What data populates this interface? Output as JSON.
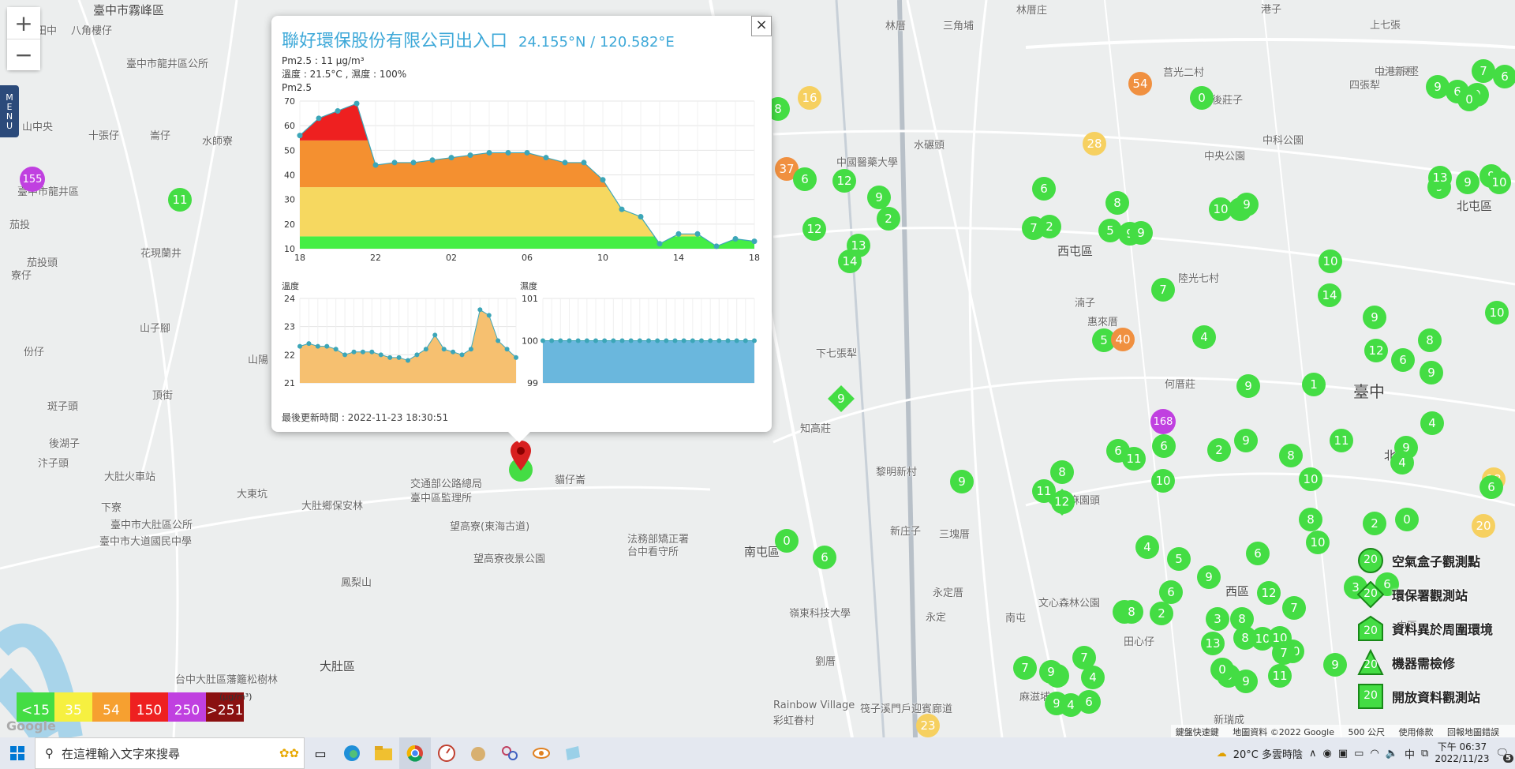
{
  "map": {
    "zoom_in": "+",
    "zoom_out": "−",
    "menu_label": "MENU",
    "places": [
      {
        "text": "臺中市霧峰區",
        "k": "district"
      },
      {
        "text": "八角樓仔"
      },
      {
        "text": "臺中市龍井區公所"
      },
      {
        "text": "田中"
      },
      {
        "text": "十張仔"
      },
      {
        "text": "崙仔"
      },
      {
        "text": "水師寮"
      },
      {
        "text": "山中央"
      },
      {
        "text": "臺中市龍井區"
      },
      {
        "text": "茄投"
      },
      {
        "text": "茄投頭"
      },
      {
        "text": "花現蘭井"
      },
      {
        "text": "寮仔"
      },
      {
        "text": "份仔"
      },
      {
        "text": "山子腳"
      },
      {
        "text": "山陽"
      },
      {
        "text": "頂街"
      },
      {
        "text": "斑子頭"
      },
      {
        "text": "後湖子"
      },
      {
        "text": "汴子頭"
      },
      {
        "text": "下寮"
      },
      {
        "text": "大肚火車站"
      },
      {
        "text": "臺中市大肚區公所"
      },
      {
        "text": "大東坑"
      },
      {
        "text": "大肚鄉保安林"
      },
      {
        "text": "交通部公路總局"
      },
      {
        "text": "臺中區監理所"
      },
      {
        "text": "望高寮(東海古道)"
      },
      {
        "text": "望高寮夜景公園"
      },
      {
        "text": "鳳梨山"
      },
      {
        "text": "臺中市大道國民中學"
      },
      {
        "text": "大肚區",
        "k": "district"
      },
      {
        "text": "台中大肚區藩籬松樹林"
      },
      {
        "text": "貓仔崙"
      },
      {
        "text": "法務部矯正署"
      },
      {
        "text": "台中看守所"
      },
      {
        "text": "林厝"
      },
      {
        "text": "三角埔"
      },
      {
        "text": "林厝庄"
      },
      {
        "text": "港子"
      },
      {
        "text": "上七張"
      },
      {
        "text": "上七張堅"
      },
      {
        "text": "中港新村"
      },
      {
        "text": "四張犁"
      },
      {
        "text": "後莊子"
      },
      {
        "text": "莒光二村"
      },
      {
        "text": "中科公園"
      },
      {
        "text": "中國醫藥大學"
      },
      {
        "text": "水碾頭"
      },
      {
        "text": "中央公園"
      },
      {
        "text": "西屯區",
        "k": "district"
      },
      {
        "text": "北屯區",
        "k": "district"
      },
      {
        "text": "陸光七村"
      },
      {
        "text": "湳子"
      },
      {
        "text": "惠來厝"
      },
      {
        "text": "下七張犁"
      },
      {
        "text": "何厝莊"
      },
      {
        "text": "臺中",
        "k": "city"
      },
      {
        "text": "北區",
        "k": "district"
      },
      {
        "text": "知高莊"
      },
      {
        "text": "黎明新村"
      },
      {
        "text": "新庄子"
      },
      {
        "text": "三塊厝"
      },
      {
        "text": "麻園頭"
      },
      {
        "text": "南屯區",
        "k": "district"
      },
      {
        "text": "永定厝"
      },
      {
        "text": "永定"
      },
      {
        "text": "南屯"
      },
      {
        "text": "文心森林公園"
      },
      {
        "text": "田心仔"
      },
      {
        "text": "西區",
        "k": "district"
      },
      {
        "text": "嶺東科技大學"
      },
      {
        "text": "劉厝"
      },
      {
        "text": "筏子溪門戶迎賓廊道"
      },
      {
        "text": "Rainbow Village"
      },
      {
        "text": "彩虹眷村"
      },
      {
        "text": "麻滋埔"
      },
      {
        "text": "新瑞成"
      },
      {
        "text": "中區"
      }
    ],
    "markers": [
      {
        "v": "155",
        "c": "#c040e0"
      },
      {
        "v": "11",
        "c": "#44dd44"
      },
      {
        "v": "8",
        "c": "#44dd44"
      },
      {
        "v": "16",
        "c": "#f6d060"
      },
      {
        "v": "37",
        "c": "#f09040"
      },
      {
        "v": "6",
        "c": "#44dd44"
      },
      {
        "v": "12",
        "c": "#44dd44"
      },
      {
        "v": "9",
        "c": "#44dd44"
      },
      {
        "v": "2",
        "c": "#44dd44"
      },
      {
        "v": "12",
        "c": "#44dd44"
      },
      {
        "v": "13",
        "c": "#44dd44"
      },
      {
        "v": "14",
        "c": "#44dd44"
      },
      {
        "v": "54",
        "c": "#f09040"
      },
      {
        "v": "0",
        "c": "#44dd44"
      },
      {
        "v": "28",
        "c": "#f6d060"
      },
      {
        "v": "6",
        "c": "#44dd44"
      },
      {
        "v": "7",
        "c": "#44dd44"
      },
      {
        "v": "2",
        "c": "#44dd44"
      },
      {
        "v": "8",
        "c": "#44dd44"
      },
      {
        "v": "5",
        "c": "#44dd44"
      },
      {
        "v": "9",
        "c": "#44dd44"
      },
      {
        "v": "9",
        "c": "#44dd44"
      },
      {
        "v": "7",
        "c": "#44dd44"
      },
      {
        "v": "5",
        "c": "#44dd44"
      },
      {
        "v": "40",
        "c": "#f09040"
      },
      {
        "v": "4",
        "c": "#44dd44"
      },
      {
        "v": "9",
        "c": "#44dd44"
      },
      {
        "v": "168",
        "c": "#c040e0"
      },
      {
        "v": "6",
        "c": "#44dd44"
      },
      {
        "v": "6",
        "c": "#44dd44"
      },
      {
        "v": "2",
        "c": "#44dd44"
      },
      {
        "v": "9",
        "c": "#44dd44"
      },
      {
        "v": "8",
        "c": "#44dd44"
      },
      {
        "v": "11",
        "c": "#44dd44"
      },
      {
        "v": "12",
        "c": "#44dd44"
      },
      {
        "v": "11",
        "c": "#44dd44"
      },
      {
        "v": "10",
        "c": "#44dd44"
      },
      {
        "v": "9",
        "c": "#44dd44"
      },
      {
        "v": "0",
        "c": "#44dd44"
      },
      {
        "v": "6",
        "c": "#44dd44"
      },
      {
        "v": "7",
        "c": "#44dd44"
      },
      {
        "v": "9",
        "c": "#44dd44"
      },
      {
        "v": "9",
        "c": "#44dd44"
      },
      {
        "v": "2",
        "c": "#44dd44"
      },
      {
        "v": "13",
        "c": "#44dd44"
      },
      {
        "v": "8",
        "c": "#44dd44"
      },
      {
        "v": "10",
        "c": "#44dd44"
      },
      {
        "v": "10",
        "c": "#44dd44"
      },
      {
        "v": "11",
        "c": "#44dd44"
      },
      {
        "v": "7",
        "c": "#44dd44"
      },
      {
        "v": "10",
        "c": "#44dd44"
      },
      {
        "v": "9",
        "c": "#44dd44"
      },
      {
        "v": "14",
        "c": "#44dd44"
      },
      {
        "v": "10",
        "c": "#44dd44"
      },
      {
        "v": "12",
        "c": "#44dd44"
      },
      {
        "v": "9",
        "c": "#44dd44"
      },
      {
        "v": "8",
        "c": "#44dd44"
      },
      {
        "v": "9",
        "c": "#44dd44"
      },
      {
        "v": "6",
        "c": "#44dd44"
      },
      {
        "v": "1",
        "c": "#44dd44"
      },
      {
        "v": "11",
        "c": "#44dd44"
      },
      {
        "v": "8",
        "c": "#44dd44"
      },
      {
        "v": "9",
        "c": "#44dd44"
      },
      {
        "v": "4",
        "c": "#44dd44"
      },
      {
        "v": "10",
        "c": "#44dd44"
      },
      {
        "v": "18",
        "c": "#f6d060"
      },
      {
        "v": "20",
        "c": "#f6d060"
      },
      {
        "v": "0",
        "c": "#44dd44"
      },
      {
        "v": "8",
        "c": "#44dd44"
      },
      {
        "v": "10",
        "c": "#44dd44"
      },
      {
        "v": "6",
        "c": "#44dd44"
      },
      {
        "v": "12",
        "c": "#44dd44"
      },
      {
        "v": "3",
        "c": "#44dd44"
      },
      {
        "v": "6",
        "c": "#44dd44"
      },
      {
        "v": "5",
        "c": "#44dd44"
      },
      {
        "v": "8",
        "c": "#44dd44"
      },
      {
        "v": "4",
        "c": "#44dd44"
      },
      {
        "v": "5",
        "c": "#44dd44"
      },
      {
        "v": "9",
        "c": "#44dd44"
      },
      {
        "v": "8",
        "c": "#44dd44"
      },
      {
        "v": "9",
        "c": "#44dd44"
      },
      {
        "v": "7",
        "c": "#44dd44"
      },
      {
        "v": "3",
        "c": "#44dd44"
      },
      {
        "v": "0",
        "c": "#44dd44"
      },
      {
        "v": "9",
        "c": "#44dd44"
      },
      {
        "v": "7",
        "c": "#44dd44"
      },
      {
        "v": "4",
        "c": "#44dd44"
      },
      {
        "v": "6",
        "c": "#44dd44"
      },
      {
        "v": "4",
        "c": "#44dd44"
      },
      {
        "v": "23",
        "c": "#f6d060"
      },
      {
        "v": "7",
        "c": "#44dd44"
      },
      {
        "v": "6",
        "c": "#44dd44"
      },
      {
        "v": "9",
        "c": "#44dd44"
      },
      {
        "v": "0",
        "c": "#44dd44"
      },
      {
        "v": "6",
        "c": "#44dd44"
      },
      {
        "v": "9",
        "c": "#44dd44"
      },
      {
        "v": "9",
        "c": "#44dd44"
      },
      {
        "v": "9",
        "c": "#44dd44"
      },
      {
        "v": "9",
        "c": "#44dd44"
      },
      {
        "v": "6",
        "c": "#44dd44"
      },
      {
        "v": "4",
        "c": "#44dd44"
      },
      {
        "v": "2",
        "c": "#44dd44"
      },
      {
        "v": "3",
        "c": "#44dd44"
      },
      {
        "v": "6",
        "c": "#44dd44"
      },
      {
        "v": "13",
        "c": "#44dd44"
      },
      {
        "v": "10",
        "c": "#44dd44"
      },
      {
        "v": "10",
        "c": "#44dd44"
      },
      {
        "v": "7",
        "c": "#44dd44"
      },
      {
        "v": "9",
        "c": "#44dd44"
      },
      {
        "v": "10",
        "c": "#44dd44"
      }
    ],
    "diamonds": [
      {
        "v": "9",
        "c": "#44dd44"
      },
      {
        "v": "12",
        "c": "#44dd44"
      }
    ]
  },
  "popup": {
    "close_label": "×",
    "station_name": "聯好環保股份有限公司出入口",
    "coordinates": "24.155°N / 120.582°E",
    "pm25_line": "Pm2.5 : 11 μg/m³",
    "weather_line": "溫度 : 21.5°C , 濕度 : 100%",
    "chart_heading": "Pm2.5",
    "updated": "最後更新時間 : 2022-11-23 18:30:51"
  },
  "chart_data": [
    {
      "type": "area",
      "title": "Pm2.5",
      "x": [
        "18",
        "19",
        "20",
        "21",
        "22",
        "23",
        "00",
        "01",
        "02",
        "03",
        "04",
        "05",
        "06",
        "07",
        "08",
        "09",
        "10",
        "11",
        "12",
        "13",
        "14",
        "15",
        "16",
        "17",
        "18"
      ],
      "x_ticks": [
        "18",
        "22",
        "02",
        "06",
        "10",
        "14",
        "18"
      ],
      "values": [
        56,
        63,
        66,
        69,
        44,
        45,
        45,
        46,
        47,
        48,
        49,
        49,
        49,
        47,
        45,
        45,
        38,
        26,
        23,
        12,
        16,
        16,
        11,
        14,
        13
      ],
      "ylim": [
        10,
        70
      ],
      "y_ticks": [
        10,
        20,
        30,
        40,
        50,
        60,
        70
      ],
      "color_bands": [
        {
          "max": 15,
          "color": "#44ee44"
        },
        {
          "max": 35,
          "color": "#f6d860"
        },
        {
          "max": 54,
          "color": "#f49030"
        },
        {
          "max": 150,
          "color": "#ee2020"
        }
      ],
      "grid": true
    },
    {
      "type": "area",
      "title": "溫度",
      "values": [
        22.3,
        22.4,
        22.3,
        22.3,
        22.2,
        22.0,
        22.1,
        22.1,
        22.1,
        22.0,
        21.9,
        21.9,
        21.8,
        22.0,
        22.2,
        22.7,
        22.2,
        22.1,
        22.0,
        22.2,
        23.6,
        23.4,
        22.5,
        22.2,
        21.9
      ],
      "ylim": [
        21,
        24
      ],
      "y_ticks": [
        21,
        22,
        23,
        24
      ],
      "color": "#f6c070",
      "grid": true
    },
    {
      "type": "area",
      "title": "濕度",
      "values": [
        100,
        100,
        100,
        100,
        100,
        100,
        100,
        100,
        100,
        100,
        100,
        100,
        100,
        100,
        100,
        100,
        100,
        100,
        100,
        100,
        100,
        100,
        100,
        100,
        100
      ],
      "ylim": [
        99,
        101
      ],
      "y_ticks": [
        99,
        100,
        101
      ],
      "color": "#6ab7dd",
      "grid": true
    }
  ],
  "legend": {
    "scale": [
      {
        "label": "<15",
        "color": "#44dd44"
      },
      {
        "label": "35",
        "color": "#f6f040"
      },
      {
        "label": "54",
        "color": "#f6a030"
      },
      {
        "label": "150",
        "color": "#ee2020"
      },
      {
        "label": "250",
        "color": "#c040e0"
      },
      {
        "label": ">251",
        "color": "#8a1010"
      }
    ],
    "unit": "(μg/m³)",
    "types": [
      {
        "label": "空氣盒子觀測點",
        "value": "20",
        "shape": "circle"
      },
      {
        "label": "環保署觀測站",
        "value": "20",
        "shape": "diamond"
      },
      {
        "label": "資料異於周圍環境",
        "value": "20",
        "shape": "house"
      },
      {
        "label": "機器需檢修",
        "value": "20",
        "shape": "triangle"
      },
      {
        "label": "開放資料觀測站",
        "value": "20",
        "shape": "square"
      }
    ]
  },
  "attribution": {
    "shortcuts": "鍵盤快速鍵",
    "map_data": "地圖資料 ©2022 Google",
    "scale": "500 公尺",
    "terms": "使用條款",
    "report": "回報地圖錯誤",
    "google": "Google"
  },
  "taskbar": {
    "search_placeholder": "在這裡輸入文字來搜尋",
    "weather": "20°C 多雲時陰",
    "ime": "中",
    "time": "下午 06:37",
    "date": "2022/11/23",
    "notifications": "5"
  }
}
